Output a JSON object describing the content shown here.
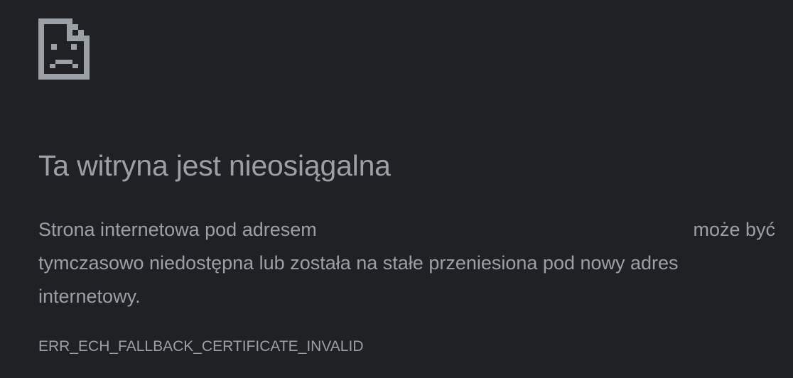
{
  "icon": "sad-page-icon",
  "colors": {
    "background": "#202124",
    "text": "#9aa0a6"
  },
  "heading": "Ta witryna jest nieosiągalna",
  "message": {
    "line1_lead": "Strona internetowa pod adresem",
    "line1_tail": "może być",
    "line2": "tymczasowo niedostępna lub została na stałe przeniesiona pod nowy adres",
    "line3": "internetowy."
  },
  "error_code": "ERR_ECH_FALLBACK_CERTIFICATE_INVALID"
}
